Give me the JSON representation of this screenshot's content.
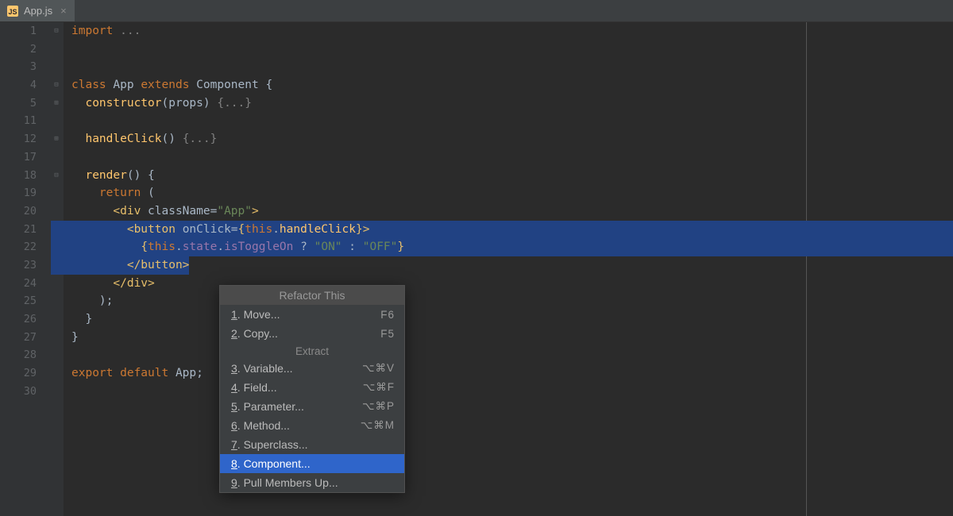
{
  "tab": {
    "filename": "App.js"
  },
  "gutter_lines": [
    "1",
    "2",
    "3",
    "4",
    "5",
    "11",
    "12",
    "17",
    "18",
    "19",
    "20",
    "21",
    "22",
    "23",
    "24",
    "25",
    "26",
    "27",
    "28",
    "29",
    "30"
  ],
  "code": {
    "l1_import": "import ",
    "l1_rest": "...",
    "l4_class": "class ",
    "l4_app": "App ",
    "l4_extends": "extends ",
    "l4_component": "Component ",
    "l4_brace": "{",
    "l5_ctor": "  constructor",
    "l5_props": "(props) ",
    "l5_fold": "{...}",
    "l12_handle": "  handleClick",
    "l12_paren": "() ",
    "l12_fold": "{...}",
    "l18_render": "  render",
    "l18_rest": "() {",
    "l19_return": "    return ",
    "l19_paren": "(",
    "l20_open": "      <div ",
    "l20_attr": "className",
    "l20_eq": "=",
    "l20_val": "\"App\"",
    "l20_close": ">",
    "l21_open": "        <button ",
    "l21_attr": "onClick",
    "l21_eq": "=",
    "l21_lcb": "{",
    "l21_this": "this",
    "l21_dot": ".",
    "l21_hc": "handleClick",
    "l21_rcb": "}",
    "l21_gt": ">",
    "l22_pad": "          ",
    "l22_lcb": "{",
    "l22_this": "this",
    "l22_dot1": ".",
    "l22_state": "state",
    "l22_dot2": ".",
    "l22_tog": "isToggleOn",
    "l22_q": " ? ",
    "l22_on": "\"ON\"",
    "l22_colon": " : ",
    "l22_off": "\"OFF\"",
    "l22_rcb": "}",
    "l23_close": "        </button>",
    "l24_close": "      </div>",
    "l25": "    );",
    "l26": "  }",
    "l27": "}",
    "l29_export": "export ",
    "l29_default": "default ",
    "l29_app": "App;"
  },
  "menu": {
    "title": "Refactor This",
    "items1": [
      {
        "n": "1",
        "label": "Move...",
        "sc": "F6"
      },
      {
        "n": "2",
        "label": "Copy...",
        "sc": "F5"
      }
    ],
    "section": "Extract",
    "items2": [
      {
        "n": "3",
        "label": "Variable...",
        "sc": "⌥⌘V"
      },
      {
        "n": "4",
        "label": "Field...",
        "sc": "⌥⌘F"
      },
      {
        "n": "5",
        "label": "Parameter...",
        "sc": "⌥⌘P"
      },
      {
        "n": "6",
        "label": "Method...",
        "sc": "⌥⌘M"
      },
      {
        "n": "7",
        "label": "Superclass...",
        "sc": ""
      },
      {
        "n": "8",
        "label": "Component...",
        "sc": "",
        "highlight": true
      },
      {
        "n": "9",
        "label": "Pull Members Up...",
        "sc": ""
      }
    ]
  }
}
